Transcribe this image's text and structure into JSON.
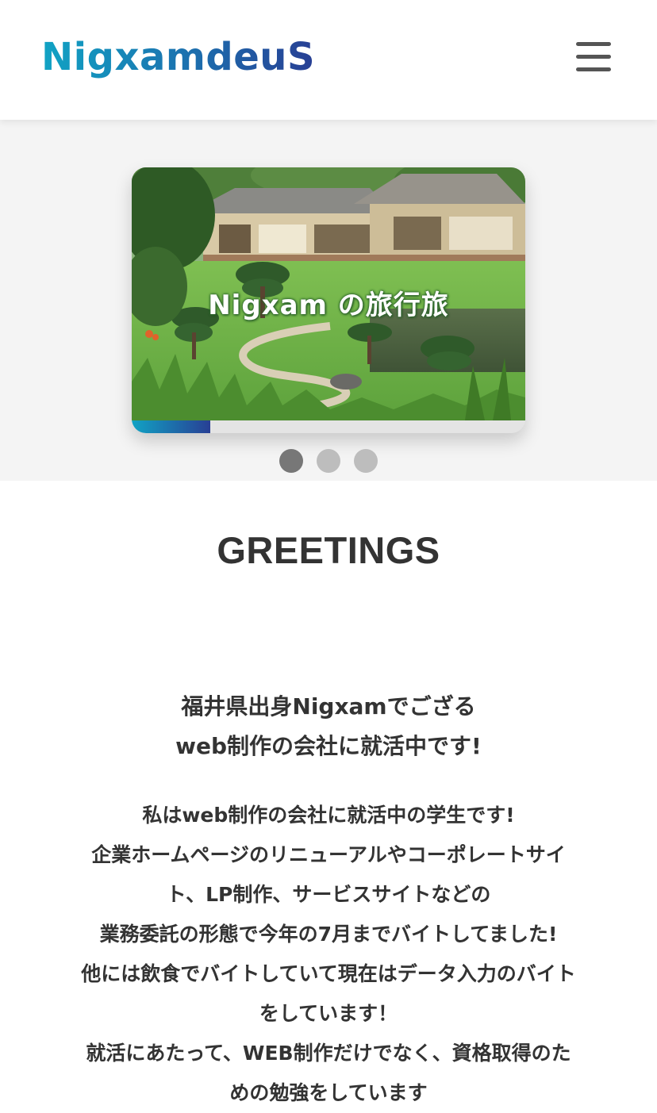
{
  "header": {
    "logo_text": "NigxamdeuS",
    "menu_icon": "hamburger-menu-icon"
  },
  "slider": {
    "slide_title": "Nigxam の旅行旅",
    "progress": 0.2,
    "dots": [
      {
        "active": true
      },
      {
        "active": false
      },
      {
        "active": false
      }
    ]
  },
  "greetings": {
    "heading": "GREETINGS",
    "intro_lines": [
      "福井県出身Nigxamでござる",
      "web制作の会社に就活中です!"
    ],
    "body_lines": [
      "私はweb制作の会社に就活中の学生です!",
      "企業ホームページのリニューアルやコーポレートサイ",
      "ト、LP制作、サービスサイトなどの",
      "業務委託の形態で今年の7月までバイトしてました!",
      "他には飲食でバイトしていて現在はデータ入力のバイト",
      "をしています！",
      "就活にあたって、WEB制作だけでなく、資格取得のた",
      "めの勉強をしています"
    ]
  },
  "colors": {
    "brand_start": "#11a3c4",
    "brand_end": "#283f94",
    "text": "#333333",
    "hero_bg": "#f4f4f4"
  }
}
